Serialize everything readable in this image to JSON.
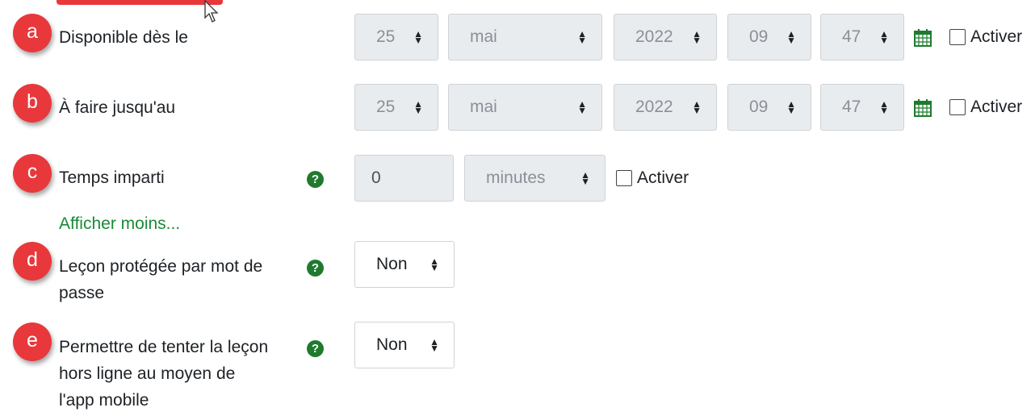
{
  "colors": {
    "badge": "#e8383b",
    "help": "#1f7a2e",
    "link": "#1b8a36",
    "calendar": "#1f7a2e"
  },
  "rows": [
    {
      "badge": "a",
      "label": "Disponible dès le",
      "day": "25",
      "month": "mai",
      "year": "2022",
      "hour": "09",
      "minute": "47",
      "enable": "Activer"
    },
    {
      "badge": "b",
      "label": "À faire jusqu'au",
      "day": "25",
      "month": "mai",
      "year": "2022",
      "hour": "09",
      "minute": "47",
      "enable": "Activer"
    },
    {
      "badge": "c",
      "label": "Temps imparti",
      "value": "0",
      "unit": "minutes",
      "enable": "Activer",
      "help_glyph": "?"
    }
  ],
  "show_less": "Afficher moins...",
  "password": {
    "badge": "d",
    "label_line1": "Leçon protégée par mot de",
    "label_line2": "passe",
    "value": "Non",
    "help_glyph": "?"
  },
  "offline": {
    "badge": "e",
    "label_line1": "Permettre de tenter la leçon",
    "label_line2": "hors ligne au moyen de",
    "label_line3": "l'app mobile",
    "value": "Non",
    "help_glyph": "?"
  },
  "icons": {
    "help": "question-circle-icon",
    "calendar": "calendar-icon",
    "checkbox": "checkbox-icon",
    "select_arrows": "sort-arrows-icon",
    "cursor": "mouse-pointer-icon"
  }
}
